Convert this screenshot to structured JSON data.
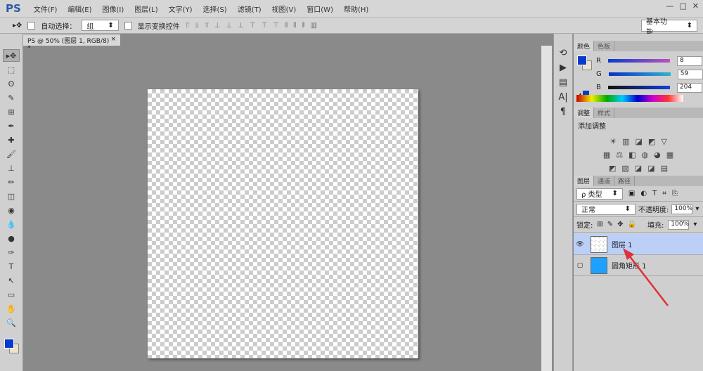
{
  "app": {
    "logo": "PS"
  },
  "menu": [
    "文件(F)",
    "编辑(E)",
    "图像(I)",
    "图层(L)",
    "文字(Y)",
    "选择(S)",
    "滤镜(T)",
    "视图(V)",
    "窗口(W)",
    "帮助(H)"
  ],
  "window_controls": [
    "—",
    "□",
    "✕"
  ],
  "options": {
    "tool": "▸✥",
    "auto_select_label": "自动选择：",
    "auto_select_value": "组",
    "show_transform_label": "显示变换控件",
    "workspace": "基本功能"
  },
  "document_tab": {
    "title": "PS @ 50% (图层 1, RGB/8) *",
    "close": "×"
  },
  "tools": [
    "▸✥",
    "⬚",
    "ʘ",
    "✎",
    "⊞",
    "✒",
    "✚",
    "🖌",
    "⊥",
    "✏",
    "◫",
    "◉",
    "💧",
    "●",
    "✑",
    "T",
    "↖",
    "▭",
    "✋",
    "🔍"
  ],
  "color_panel": {
    "tabs": [
      "颜色",
      "色板"
    ],
    "channels": [
      {
        "label": "R",
        "value": "8"
      },
      {
        "label": "G",
        "value": "59"
      },
      {
        "label": "B",
        "value": "204"
      }
    ],
    "foreground": "#083bcc",
    "background": "#ede2c8"
  },
  "adjust_panel": {
    "tabs": [
      "调整",
      "样式"
    ],
    "title": "添加调整",
    "icons_row1": [
      "☀",
      "▥",
      "◪",
      "◩",
      "▽"
    ],
    "icons_row2": [
      "▦",
      "⚖",
      "◧",
      "◍",
      "◕",
      "▦"
    ],
    "icons_row3": [
      "◩",
      "▨",
      "◪",
      "◪",
      "▤"
    ]
  },
  "layers_panel": {
    "tabs": [
      "图层",
      "通道",
      "路径"
    ],
    "filter": "ρ 类型",
    "filter_icons": [
      "▣",
      "◐",
      "T",
      "⌗",
      "⎘"
    ],
    "blend_mode": "正常",
    "opacity_label": "不透明度:",
    "opacity": "100%",
    "lock_label": "锁定:",
    "lock_icons": [
      "⊞",
      "✎",
      "✥",
      "🔒"
    ],
    "fill_label": "填充:",
    "fill": "100%",
    "layers": [
      {
        "name": "图层 1",
        "visible": true,
        "selected": true
      },
      {
        "name": "圆角矩形 1",
        "visible": false,
        "selected": false
      }
    ]
  }
}
